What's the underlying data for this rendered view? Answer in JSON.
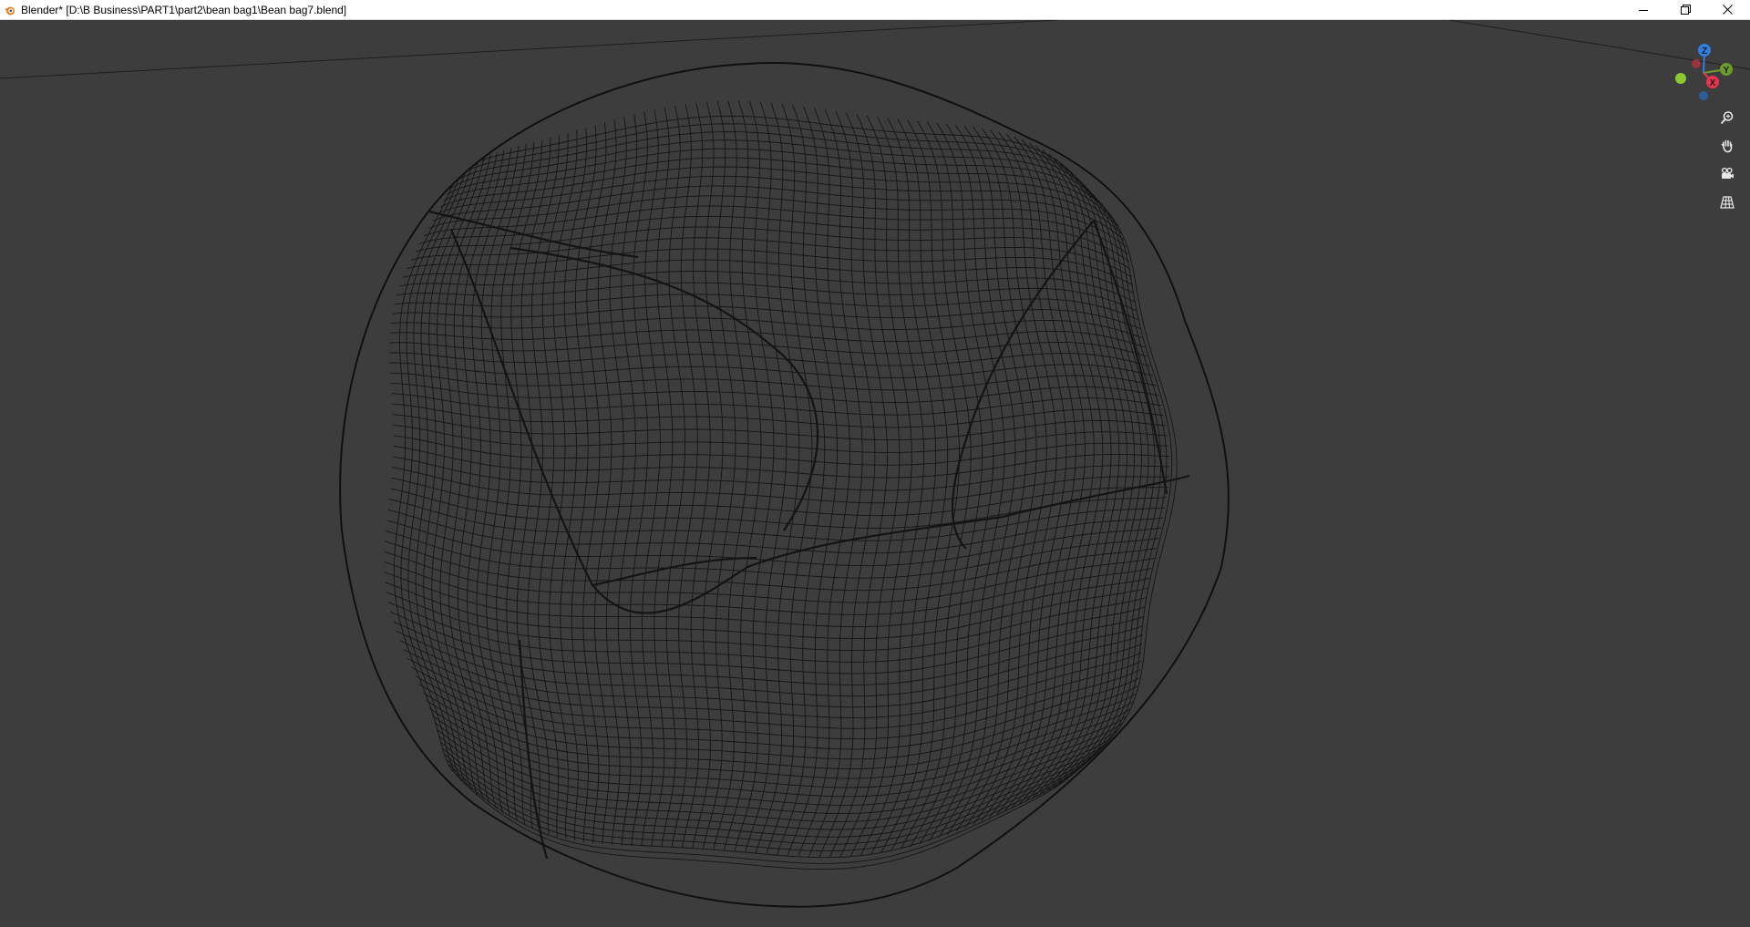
{
  "window": {
    "title": "Blender* [D:\\B Business\\PART1\\part2\\bean bag1\\Bean bag7.blend]",
    "controls": [
      "minimize",
      "restore",
      "close"
    ]
  },
  "viewport": {
    "background_color": "#3d3d3d",
    "object": "bean bag wireframe mesh",
    "shading": "wireframe",
    "wire_color": "#151515"
  },
  "gizmo": {
    "axes": {
      "z": {
        "label": "Z",
        "color": "#2f7fe0"
      },
      "y": {
        "label": "Y",
        "color": "#6e9a2a"
      },
      "x": {
        "label": "X",
        "color": "#e8344f"
      }
    },
    "negative_axes": {
      "x_neg_color": "#9a3342",
      "y_neg_color": "#8cc832",
      "z_neg_color": "#2d5e9b"
    }
  },
  "nav_tools": [
    {
      "name": "zoom",
      "icon": "zoom-icon"
    },
    {
      "name": "pan",
      "icon": "hand-icon"
    },
    {
      "name": "camera",
      "icon": "camera-icon"
    },
    {
      "name": "ortho-perspective",
      "icon": "grid-icon"
    }
  ]
}
